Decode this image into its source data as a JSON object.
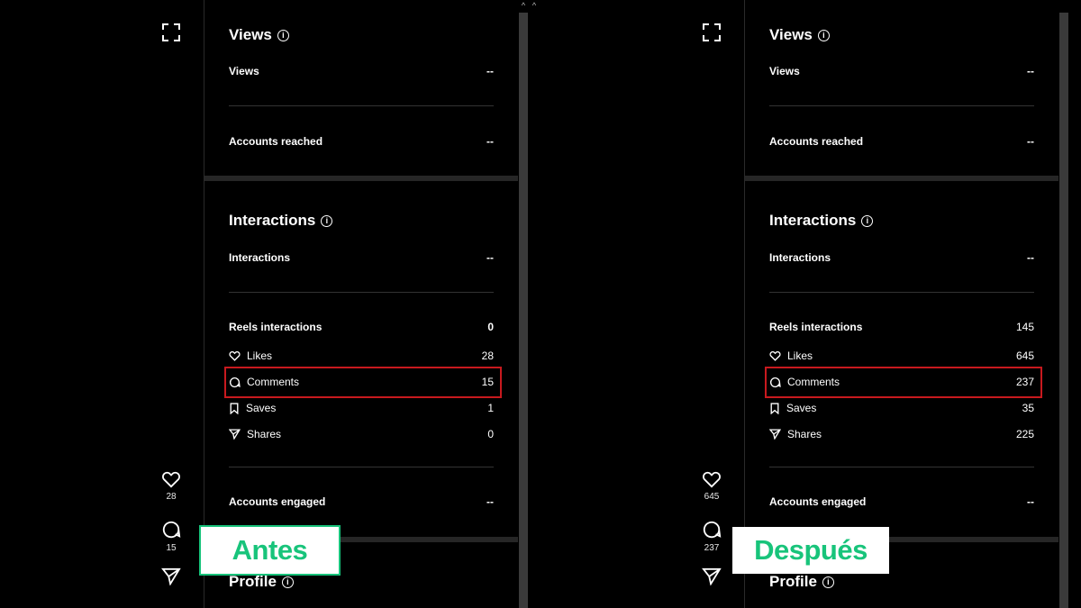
{
  "panels": [
    {
      "id": "left",
      "rail": {
        "likes": "28",
        "comments": "15"
      },
      "views": {
        "title": "Views",
        "views_label": "Views",
        "views_value": "--",
        "reached_label": "Accounts reached",
        "reached_value": "--"
      },
      "interactions": {
        "title": "Interactions",
        "interactions_label": "Interactions",
        "interactions_value": "--",
        "reels_label": "Reels interactions",
        "reels_value": "0",
        "likes_label": "Likes",
        "likes_value": "28",
        "comments_label": "Comments",
        "comments_value": "15",
        "saves_label": "Saves",
        "saves_value": "1",
        "shares_label": "Shares",
        "shares_value": "0",
        "engaged_label": "Accounts engaged",
        "engaged_value": "--"
      },
      "profile": {
        "title": "Profile"
      },
      "badge": "Antes"
    },
    {
      "id": "right",
      "rail": {
        "likes": "645",
        "comments": "237"
      },
      "views": {
        "title": "Views",
        "views_label": "Views",
        "views_value": "--",
        "reached_label": "Accounts reached",
        "reached_value": "--"
      },
      "interactions": {
        "title": "Interactions",
        "interactions_label": "Interactions",
        "interactions_value": "--",
        "reels_label": "Reels interactions",
        "reels_value": "145",
        "likes_label": "Likes",
        "likes_value": "645",
        "comments_label": "Comments",
        "comments_value": "237",
        "saves_label": "Saves",
        "saves_value": "35",
        "shares_label": "Shares",
        "shares_value": "225",
        "engaged_label": "Accounts engaged",
        "engaged_value": "--"
      },
      "profile": {
        "title": "Profile"
      },
      "badge": "Después"
    }
  ],
  "colors": {
    "highlight": "#c8191e",
    "badge_text": "#18c47b",
    "background": "#000000"
  },
  "icons": [
    "expand-icon",
    "heart-icon",
    "comment-icon",
    "send-icon",
    "info-icon",
    "bookmark-icon",
    "scroll-up-icon"
  ]
}
